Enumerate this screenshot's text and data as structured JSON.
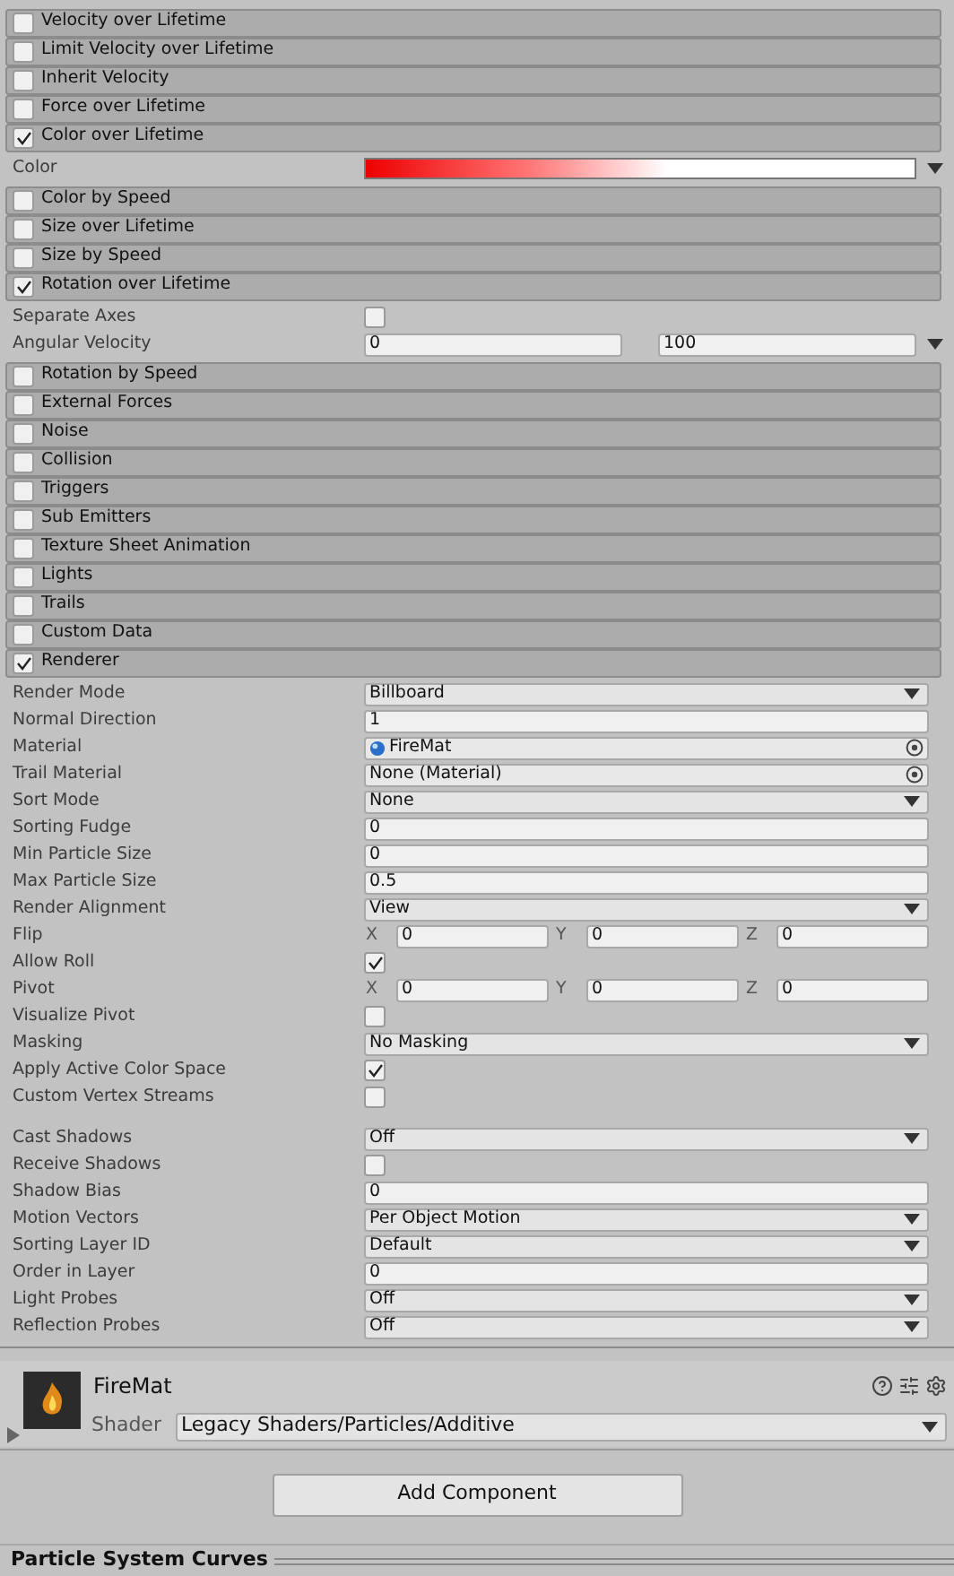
{
  "modules": [
    {
      "title": "Velocity over Lifetime",
      "enabled": false
    },
    {
      "title": "Limit Velocity over Lifetime",
      "enabled": false
    },
    {
      "title": "Inherit Velocity",
      "enabled": false
    },
    {
      "title": "Force over Lifetime",
      "enabled": false
    },
    {
      "title": "Color over Lifetime",
      "enabled": true,
      "properties": [
        {
          "kind": "gradient",
          "label": "Color"
        }
      ]
    },
    {
      "title": "Color by Speed",
      "enabled": false
    },
    {
      "title": "Size over Lifetime",
      "enabled": false
    },
    {
      "title": "Size by Speed",
      "enabled": false
    },
    {
      "title": "Rotation over Lifetime",
      "enabled": true,
      "properties": [
        {
          "kind": "checkbox",
          "label": "Separate Axes",
          "checked": false
        },
        {
          "kind": "minmax",
          "label": "Angular Velocity",
          "values": [
            "0",
            "100"
          ]
        }
      ]
    },
    {
      "title": "Rotation by Speed",
      "enabled": false
    },
    {
      "title": "External Forces",
      "enabled": false
    },
    {
      "title": "Noise",
      "enabled": false
    },
    {
      "title": "Collision",
      "enabled": false
    },
    {
      "title": "Triggers",
      "enabled": false
    },
    {
      "title": "Sub Emitters",
      "enabled": false
    },
    {
      "title": "Texture Sheet Animation",
      "enabled": false
    },
    {
      "title": "Lights",
      "enabled": false
    },
    {
      "title": "Trails",
      "enabled": false
    },
    {
      "title": "Custom Data",
      "enabled": false
    },
    {
      "title": "Renderer",
      "enabled": true,
      "properties": [
        {
          "kind": "dropdown",
          "label": "Render Mode",
          "value": "Billboard"
        },
        {
          "kind": "text",
          "label": "Normal Direction",
          "value": "1"
        },
        {
          "kind": "object",
          "label": "Material",
          "value": "FireMat",
          "asset_icon": true
        },
        {
          "kind": "object",
          "label": "Trail Material",
          "value": "None (Material)",
          "asset_icon": false
        },
        {
          "kind": "dropdown",
          "label": "Sort Mode",
          "value": "None"
        },
        {
          "kind": "text",
          "label": "Sorting Fudge",
          "value": "0"
        },
        {
          "kind": "text",
          "label": "Min Particle Size",
          "value": "0"
        },
        {
          "kind": "text",
          "label": "Max Particle Size",
          "value": "0.5"
        },
        {
          "kind": "dropdown",
          "label": "Render Alignment",
          "value": "View"
        },
        {
          "kind": "xyz",
          "label": "Flip",
          "fields": [
            {
              "axis": "X",
              "value": "0"
            },
            {
              "axis": "Y",
              "value": "0"
            },
            {
              "axis": "Z",
              "value": "0"
            }
          ]
        },
        {
          "kind": "checkbox",
          "label": "Allow Roll",
          "checked": true
        },
        {
          "kind": "xyz",
          "label": "Pivot",
          "fields": [
            {
              "axis": "X",
              "value": "0"
            },
            {
              "axis": "Y",
              "value": "0"
            },
            {
              "axis": "Z",
              "value": "0"
            }
          ]
        },
        {
          "kind": "checkbox",
          "label": "Visualize Pivot",
          "checked": false
        },
        {
          "kind": "dropdown",
          "label": "Masking",
          "value": "No Masking"
        },
        {
          "kind": "checkbox",
          "label": "Apply Active Color Space",
          "checked": true
        },
        {
          "kind": "checkbox",
          "label": "Custom Vertex Streams",
          "checked": false
        },
        {
          "kind": "gap"
        },
        {
          "kind": "dropdown",
          "label": "Cast Shadows",
          "value": "Off"
        },
        {
          "kind": "checkbox",
          "label": "Receive Shadows",
          "checked": false
        },
        {
          "kind": "text",
          "label": "Shadow Bias",
          "value": "0"
        },
        {
          "kind": "dropdown",
          "label": "Motion Vectors",
          "value": "Per Object Motion"
        },
        {
          "kind": "dropdown",
          "label": "Sorting Layer ID",
          "value": "Default"
        },
        {
          "kind": "text",
          "label": "Order in Layer",
          "value": "0"
        },
        {
          "kind": "dropdown",
          "label": "Light Probes",
          "value": "Off"
        },
        {
          "kind": "dropdown",
          "label": "Reflection Probes",
          "value": "Off"
        }
      ]
    }
  ],
  "material": {
    "name": "FireMat",
    "shader_label": "Shader",
    "shader": "Legacy Shaders/Particles/Additive"
  },
  "add_component": "Add Component",
  "footer": "Particle System Curves"
}
